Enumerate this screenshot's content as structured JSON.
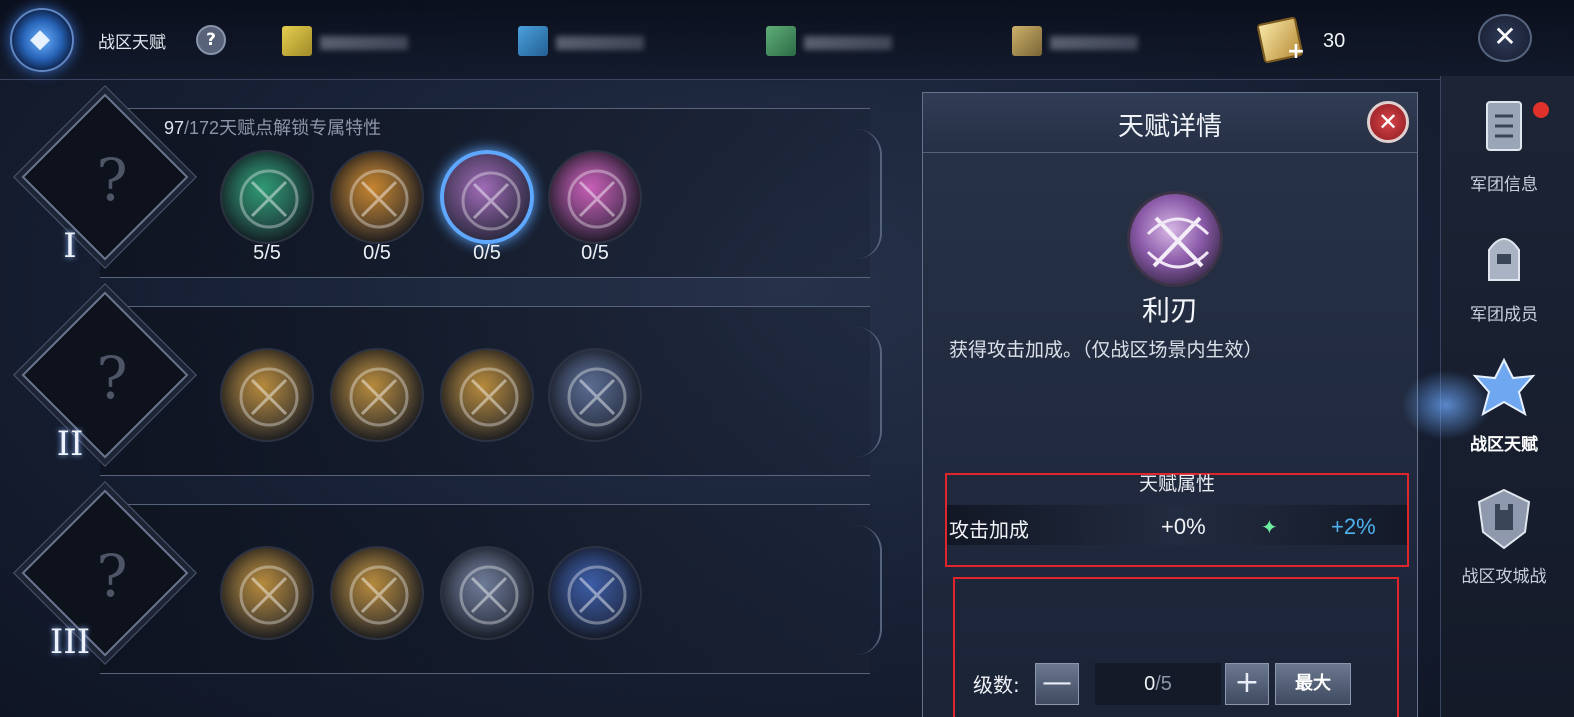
{
  "header": {
    "title": "战区天赋",
    "help_label": "?",
    "resources": [
      {
        "name": "yellow-resource",
        "color": "#d9c24a"
      },
      {
        "name": "blue-resource",
        "color": "#3d8fcf"
      },
      {
        "name": "green-resource",
        "color": "#4d9c66"
      },
      {
        "name": "gold-resource",
        "color": "#b39a5b"
      }
    ],
    "coin_count": "30",
    "close_label": "✕"
  },
  "tiers": [
    {
      "numeral": "I",
      "info_current": "97",
      "info_rest": "/172天赋点解锁专属特性",
      "talents": [
        {
          "icon": "bow-archer-icon",
          "level": "5/5",
          "color": "#2f9a74",
          "selected": false
        },
        {
          "icon": "flame-chain-icon",
          "level": "0/5",
          "color": "#c6852f",
          "selected": false
        },
        {
          "icon": "crossed-swords-icon",
          "level": "0/5",
          "color": "#a06cb8",
          "selected": true
        },
        {
          "icon": "pink-sword-icon",
          "level": "0/5",
          "color": "#c95fb8",
          "selected": false
        }
      ]
    },
    {
      "numeral": "II",
      "talents": [
        {
          "icon": "fortress-gold-icon",
          "color": "#b68a3c"
        },
        {
          "icon": "warrior-slash-icon",
          "color": "#b68a3c"
        },
        {
          "icon": "shield-helm-icon",
          "color": "#b68a3c"
        },
        {
          "icon": "spirit-blue-icon",
          "color": "#5a6c92"
        }
      ]
    },
    {
      "numeral": "III",
      "talents": [
        {
          "icon": "cannon-gold-icon",
          "color": "#b68a3c"
        },
        {
          "icon": "cart-gold-icon",
          "color": "#b68a3c"
        },
        {
          "icon": "star-burst-icon",
          "color": "#6f7c98"
        },
        {
          "icon": "blade-moon-icon",
          "color": "#3c5ca6"
        }
      ]
    }
  ],
  "panel": {
    "title": "天赋详情",
    "close_label": "✕",
    "talent_name": "利刃",
    "description": "获得攻击加成。（仅战区场景内生效）",
    "attr_title": "天赋属性",
    "attr_name": "攻击加成",
    "attr_current": "+0%",
    "attr_next": "+2%",
    "level_label": "级数:",
    "level_current": "0",
    "level_max": "/5",
    "minus_label": "—",
    "plus_label": "+",
    "max_label": "最大"
  },
  "sidenav": [
    {
      "label": "军团信息",
      "icon": "legion-info-icon",
      "badge": true
    },
    {
      "label": "军团成员",
      "icon": "legion-member-icon"
    },
    {
      "label": "战区天赋",
      "icon": "zone-talent-icon",
      "active": true
    },
    {
      "label": "战区攻城战",
      "icon": "siege-castle-icon"
    }
  ],
  "colors": {
    "accent_blue": "#4db2ee",
    "highlight_red": "#e0262b",
    "selected_ring": "#5fa8ff"
  }
}
